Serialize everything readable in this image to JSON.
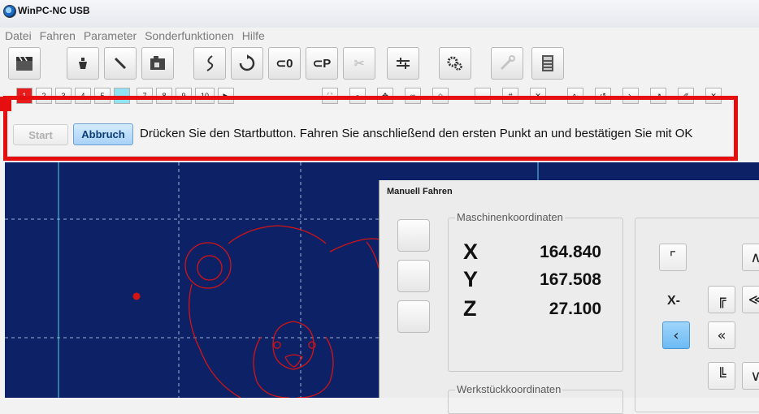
{
  "window": {
    "title": "WinPC-NC USB"
  },
  "menu": [
    "Datei",
    "Fahren",
    "Parameter",
    "Sonderfunktionen",
    "Hilfe"
  ],
  "toolbar": {
    "buttons": [
      {
        "name": "clapper-icon",
        "glyph": "🎬"
      },
      {
        "name": "pot-icon",
        "glyph": "⛟"
      },
      {
        "name": "pen-icon",
        "glyph": "✎"
      },
      {
        "name": "camera-icon",
        "glyph": "📷"
      },
      {
        "name": "path-icon",
        "glyph": "ʃ"
      },
      {
        "name": "rotate-icon",
        "glyph": "⟳"
      },
      {
        "name": "goto-zero-icon",
        "glyph": "⊂0"
      },
      {
        "name": "goto-park-icon",
        "glyph": "⊂P"
      },
      {
        "name": "tool-change-icon",
        "glyph": "✂"
      },
      {
        "name": "sliders-icon",
        "glyph": "⫩"
      },
      {
        "name": "gears-icon",
        "glyph": "⚙"
      },
      {
        "name": "wrench-icon",
        "glyph": "🔧"
      },
      {
        "name": "calculator-icon",
        "glyph": "▤"
      }
    ],
    "layer_buttons": [
      "1",
      "2",
      "3",
      "4",
      "5",
      "6",
      "7",
      "8",
      "9",
      "10"
    ]
  },
  "action": {
    "start_label": "Start",
    "abort_label": "Abbruch",
    "instruction": "Drücken Sie den Startbutton. Fahren Sie anschließend den ersten Punkt an und bestätigen Sie mit OK"
  },
  "colors": {
    "highlight": "#e60f0f",
    "canvas_bg": "#0d2266",
    "drawing": "#d31414",
    "accent": "#6cbaf3"
  },
  "manual_move": {
    "title": "Manuell Fahren",
    "machine_coords_label": "Maschinenkoordinaten",
    "workpiece_coords_label": "Werkstückkoordinaten",
    "axes": [
      {
        "axis": "X",
        "value": "164.840"
      },
      {
        "axis": "Y",
        "value": "167.508"
      },
      {
        "axis": "Z",
        "value": "27.100"
      }
    ],
    "x_minus_label": "X-"
  }
}
